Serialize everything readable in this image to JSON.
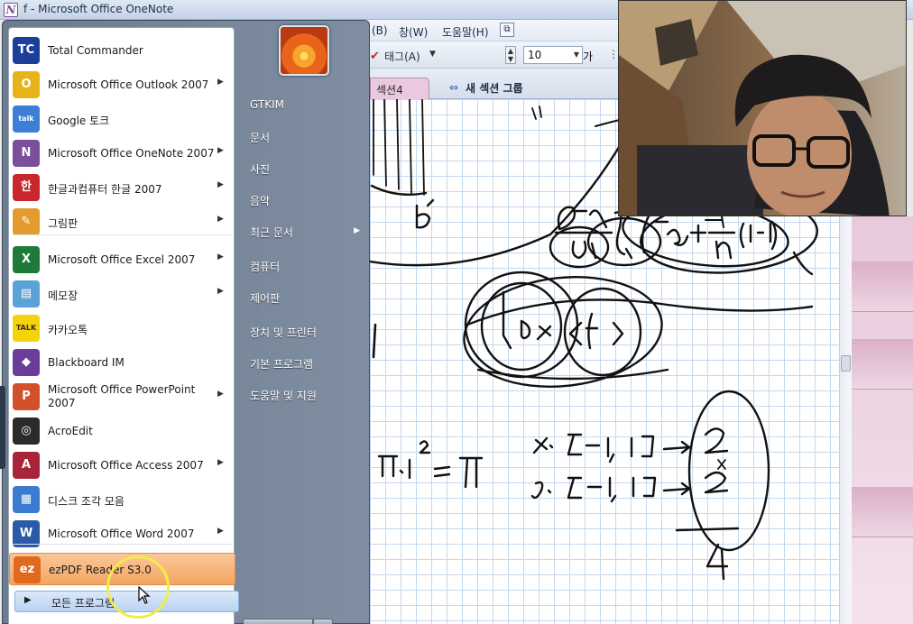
{
  "window": {
    "title": "f - Microsoft Office OneNote",
    "app_icon": "onenote-icon"
  },
  "menubar": {
    "items": [
      "(B)",
      "창(W)",
      "도움말(H)"
    ]
  },
  "toolbar": {
    "tag_label": "태그(A)",
    "font_size": "10",
    "bold_label": "가"
  },
  "sections": {
    "active_tab": "섹션4",
    "new_group_label": "새 섹션 그룹"
  },
  "start_menu": {
    "programs": [
      {
        "label": "Total Commander",
        "icon": "total-commander-icon",
        "color": "#1c3f9a",
        "arrow": false
      },
      {
        "label": "Microsoft Office Outlook 2007",
        "icon": "outlook-icon",
        "color": "#e8b21a",
        "arrow": true
      },
      {
        "label": "Google 토크",
        "icon": "google-talk-icon",
        "color": "#3c7fd6",
        "arrow": false
      },
      {
        "label": "Microsoft Office OneNote 2007",
        "icon": "onenote-icon",
        "color": "#7b4f99",
        "arrow": true
      },
      {
        "label": "한글과컴퓨터 한글 2007",
        "icon": "hangul-icon",
        "color": "#c8272e",
        "arrow": true
      },
      {
        "label": "그림판",
        "icon": "paint-icon",
        "color": "#e39b2e",
        "arrow": true
      },
      {
        "label": "Microsoft Office Excel 2007",
        "icon": "excel-icon",
        "color": "#1f7a3a",
        "arrow": true
      },
      {
        "label": "메모장",
        "icon": "notepad-icon",
        "color": "#5aa2d8",
        "arrow": true
      },
      {
        "label": "카카오톡",
        "icon": "kakaotalk-icon",
        "color": "#f3d40c",
        "arrow": false
      },
      {
        "label": "Blackboard IM",
        "icon": "blackboard-icon",
        "color": "#6a3d9a",
        "arrow": false
      },
      {
        "label": "Microsoft Office PowerPoint 2007",
        "icon": "powerpoint-icon",
        "color": "#d2512a",
        "arrow": true
      },
      {
        "label": "AcroEdit",
        "icon": "acroedit-icon",
        "color": "#2b2b2b",
        "arrow": false
      },
      {
        "label": "Microsoft Office Access 2007",
        "icon": "access-icon",
        "color": "#a8243b",
        "arrow": true
      },
      {
        "label": "디스크 조각 모음",
        "icon": "disk-defrag-icon",
        "color": "#3b7bd1",
        "arrow": false
      },
      {
        "label": "Microsoft Office Word 2007",
        "icon": "word-icon",
        "color": "#2a5aa8",
        "arrow": true
      },
      {
        "label": "ezPDF Reader S3.0",
        "icon": "ezpdf-icon",
        "color": "#e1691e",
        "arrow": false
      }
    ],
    "all_programs": "모든 프로그램",
    "places": [
      {
        "label": "GTKIM",
        "arrow": false
      },
      {
        "label": "문서",
        "arrow": false
      },
      {
        "label": "사진",
        "arrow": false
      },
      {
        "label": "음악",
        "arrow": false
      },
      {
        "label": "최근 문서",
        "arrow": true
      },
      {
        "label": "컴퓨터",
        "arrow": false
      },
      {
        "label": "제어판",
        "arrow": false
      },
      {
        "label": "장치 및 프린터",
        "arrow": false
      },
      {
        "label": "기본 프로그램",
        "arrow": false
      },
      {
        "label": "도움말 및 지원",
        "arrow": false
      }
    ]
  }
}
